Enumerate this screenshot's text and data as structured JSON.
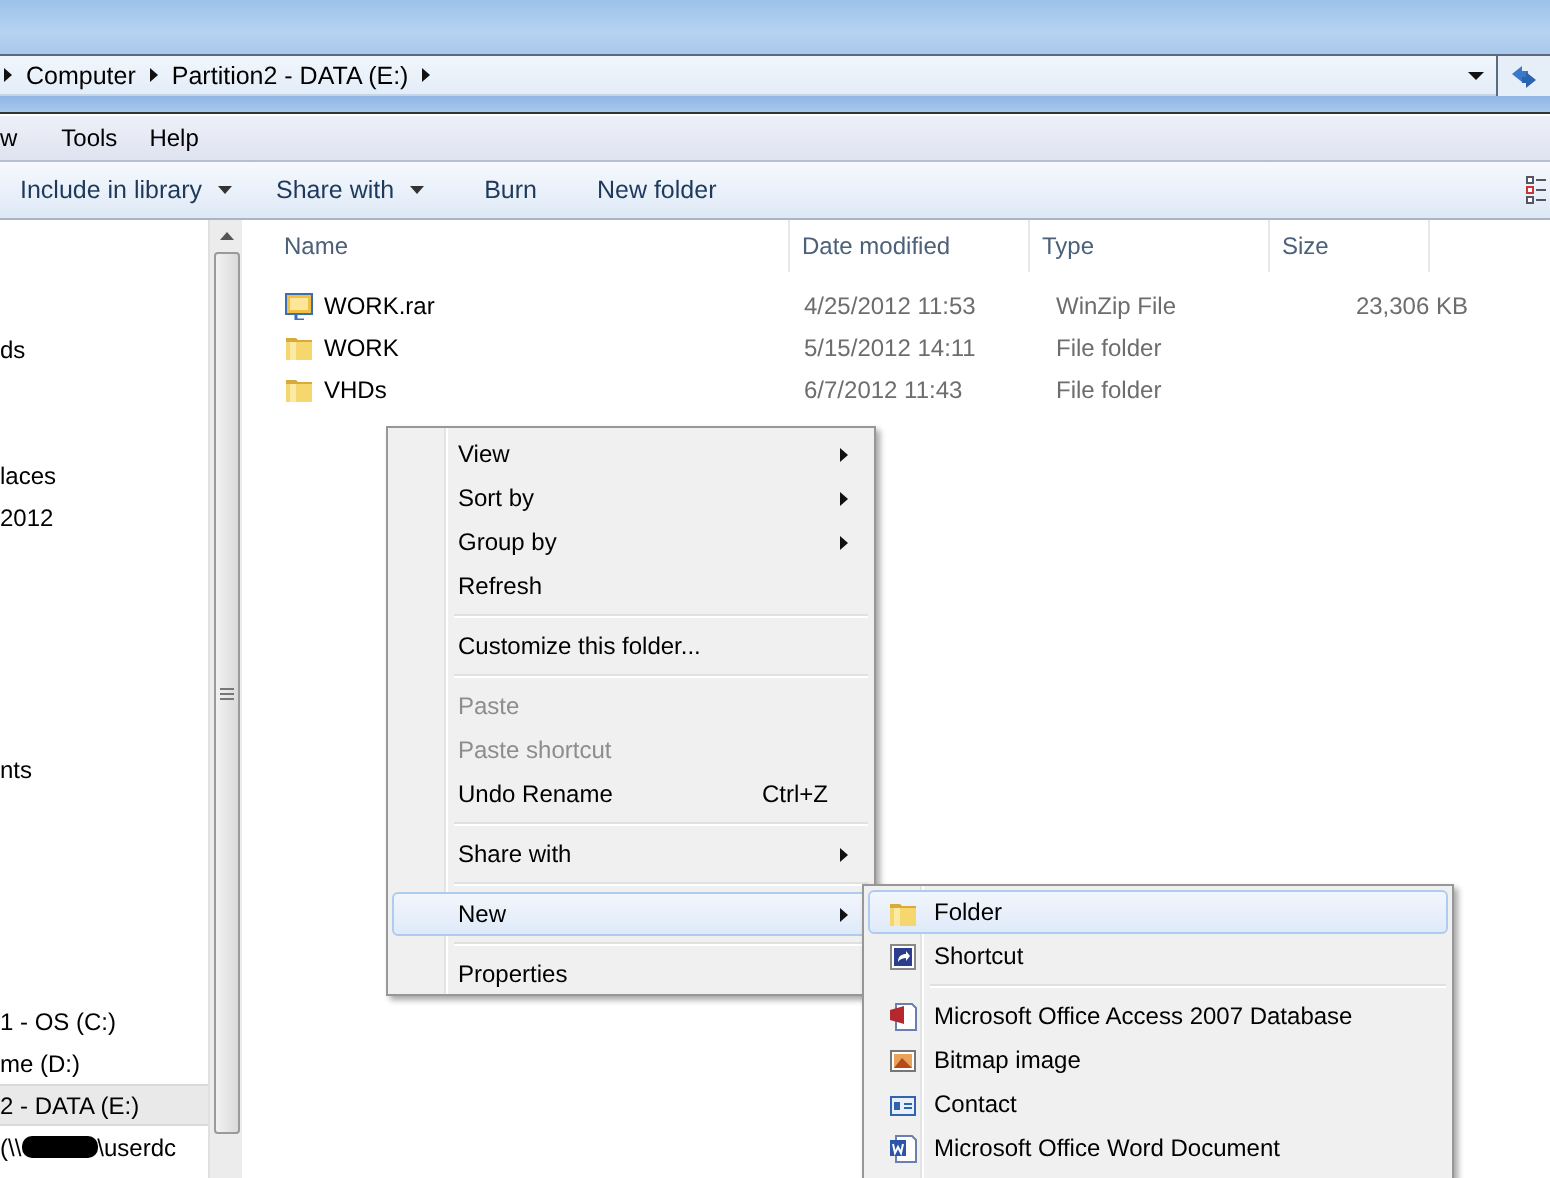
{
  "address_bar": {
    "crumbs": [
      "Computer",
      "Partition2 - DATA  (E:)"
    ]
  },
  "menu_bar": [
    "w",
    "Tools",
    "Help"
  ],
  "toolbar": [
    {
      "label": "Include in library",
      "dropdown": true
    },
    {
      "label": "Share with",
      "dropdown": true
    },
    {
      "label": "Burn",
      "dropdown": false
    },
    {
      "label": "New folder",
      "dropdown": false
    }
  ],
  "sidebar": {
    "items": [
      {
        "label": "ds",
        "selected": false
      },
      {
        "label": "laces",
        "selected": false
      },
      {
        "label": "2012",
        "selected": false
      },
      {
        "label": "nts",
        "selected": false
      },
      {
        "label": "1 - OS (C:)",
        "selected": false
      },
      {
        "label": "me (D:)",
        "selected": false
      },
      {
        "label": "2 - DATA  (E:)",
        "selected": true
      },
      {
        "label": "(\\\\",
        "label_2": "\\userdc",
        "selected": false
      }
    ]
  },
  "table": {
    "columns": [
      "Name",
      "Date modified",
      "Type",
      "Size"
    ],
    "rows": [
      {
        "kind": "archive",
        "name": "WORK.rar",
        "date": "4/25/2012 11:53",
        "type": "WinZip File",
        "size": "23,306 KB"
      },
      {
        "kind": "folder",
        "name": "WORK",
        "date": "5/15/2012 14:11",
        "type": "File folder",
        "size": ""
      },
      {
        "kind": "folder",
        "name": "VHDs",
        "date": "6/7/2012 11:43",
        "type": "File folder",
        "size": ""
      }
    ]
  },
  "context_menu": {
    "items": [
      {
        "kind": "item",
        "label": "View",
        "submenu": true,
        "disabled": false,
        "selected": false
      },
      {
        "kind": "item",
        "label": "Sort by",
        "submenu": true,
        "disabled": false,
        "selected": false
      },
      {
        "kind": "item",
        "label": "Group by",
        "submenu": true,
        "disabled": false,
        "selected": false
      },
      {
        "kind": "item",
        "label": "Refresh",
        "submenu": false,
        "disabled": false,
        "selected": false
      },
      {
        "kind": "separator"
      },
      {
        "kind": "item",
        "label": "Customize this folder...",
        "submenu": false,
        "disabled": false,
        "selected": false
      },
      {
        "kind": "separator"
      },
      {
        "kind": "item",
        "label": "Paste",
        "submenu": false,
        "disabled": true,
        "selected": false
      },
      {
        "kind": "item",
        "label": "Paste shortcut",
        "submenu": false,
        "disabled": true,
        "selected": false
      },
      {
        "kind": "item",
        "label": "Undo Rename",
        "shortcut": "Ctrl+Z",
        "submenu": false,
        "disabled": false,
        "selected": false
      },
      {
        "kind": "separator"
      },
      {
        "kind": "item",
        "label": "Share with",
        "submenu": true,
        "disabled": false,
        "selected": false
      },
      {
        "kind": "separator"
      },
      {
        "kind": "item",
        "label": "New",
        "submenu": true,
        "disabled": false,
        "selected": true
      },
      {
        "kind": "separator"
      },
      {
        "kind": "item",
        "label": "Properties",
        "submenu": false,
        "disabled": false,
        "selected": false
      }
    ]
  },
  "new_submenu": {
    "items": [
      {
        "kind": "item",
        "label": "Folder",
        "selected": true
      },
      {
        "kind": "item",
        "label": "Shortcut",
        "selected": false
      },
      {
        "kind": "separator"
      },
      {
        "kind": "item",
        "label": "Microsoft Office Access 2007 Database",
        "selected": false
      },
      {
        "kind": "item",
        "label": "Bitmap image",
        "selected": false
      },
      {
        "kind": "item",
        "label": "Contact",
        "selected": false
      },
      {
        "kind": "item",
        "label": "Microsoft Office Word Document",
        "selected": false
      }
    ]
  }
}
